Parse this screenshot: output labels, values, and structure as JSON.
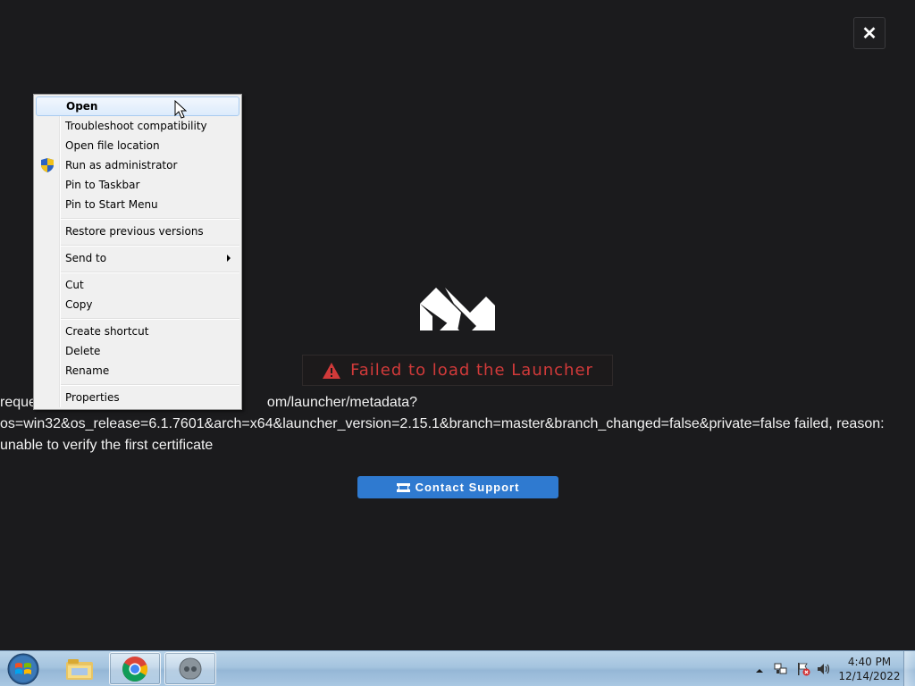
{
  "launcher": {
    "close_symbol": "✕",
    "error_title": "Failed to load the Launcher",
    "error_lines": [
      "reque",
      "om/launcher/metadata?",
      "os=win32&os_release=6.1.7601&arch=x64&launcher_version=2.15.1&branch=master&branch_changed=false&private=false failed, reason:",
      "unable to verify the first certificate"
    ],
    "contact_button": "Contact Support",
    "accent_color": "#2f7ad0",
    "error_color": "#d13a3a"
  },
  "context_menu": {
    "items": [
      {
        "label": "Open",
        "bold": true,
        "hover": true
      },
      {
        "label": "Troubleshoot compatibility"
      },
      {
        "label": "Open file location"
      },
      {
        "label": "Run as administrator",
        "icon": "shield-icon"
      },
      {
        "label": "Pin to Taskbar"
      },
      {
        "label": "Pin to Start Menu"
      },
      {
        "label": "Restore previous versions"
      },
      {
        "label": "Send to",
        "submenu": true
      },
      {
        "label": "Cut"
      },
      {
        "label": "Copy"
      },
      {
        "label": "Create shortcut"
      },
      {
        "label": "Delete"
      },
      {
        "label": "Rename"
      },
      {
        "label": "Properties"
      }
    ]
  },
  "taskbar": {
    "apps": [
      "windows-explorer-icon",
      "chrome-icon",
      "launcher-app-icon"
    ],
    "tray_icons": [
      "show-hidden-icons-arrow",
      "network-icon",
      "action-center-flag-icon",
      "volume-icon"
    ],
    "clock": {
      "time": "4:40 PM",
      "date": "12/14/2022"
    }
  }
}
